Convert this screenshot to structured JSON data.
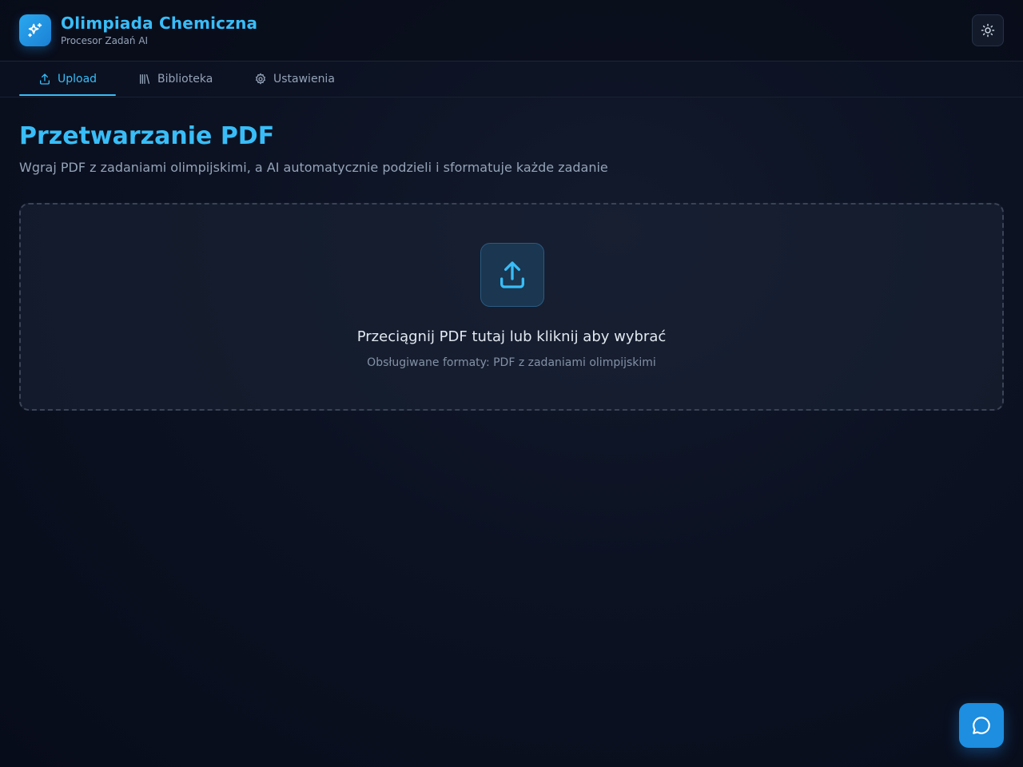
{
  "header": {
    "app_title": "Olimpiada Chemiczna",
    "app_subtitle": "Procesor Zadań AI",
    "logo_icon": "sparkles-icon",
    "theme_toggle_icon": "sun-icon"
  },
  "nav": {
    "tabs": [
      {
        "label": "Upload",
        "icon": "upload-icon",
        "active": true
      },
      {
        "label": "Biblioteka",
        "icon": "library-icon",
        "active": false
      },
      {
        "label": "Ustawienia",
        "icon": "gear-icon",
        "active": false
      }
    ]
  },
  "main": {
    "title": "Przetwarzanie PDF",
    "subtitle": "Wgraj PDF z zadaniami olimpijskimi, a AI automatycznie podzieli i sformatuje każde zadanie",
    "dropzone": {
      "title": "Przeciągnij PDF tutaj lub kliknij aby wybrać",
      "hint": "Obsługiwane formaty: PDF z zadaniami olimpijskimi",
      "icon": "upload-icon"
    }
  },
  "chat": {
    "icon": "chat-bubble-icon"
  },
  "colors": {
    "accent": "#38bdf8",
    "background": "#0c1222",
    "chat_button": "#1d8ee0"
  }
}
